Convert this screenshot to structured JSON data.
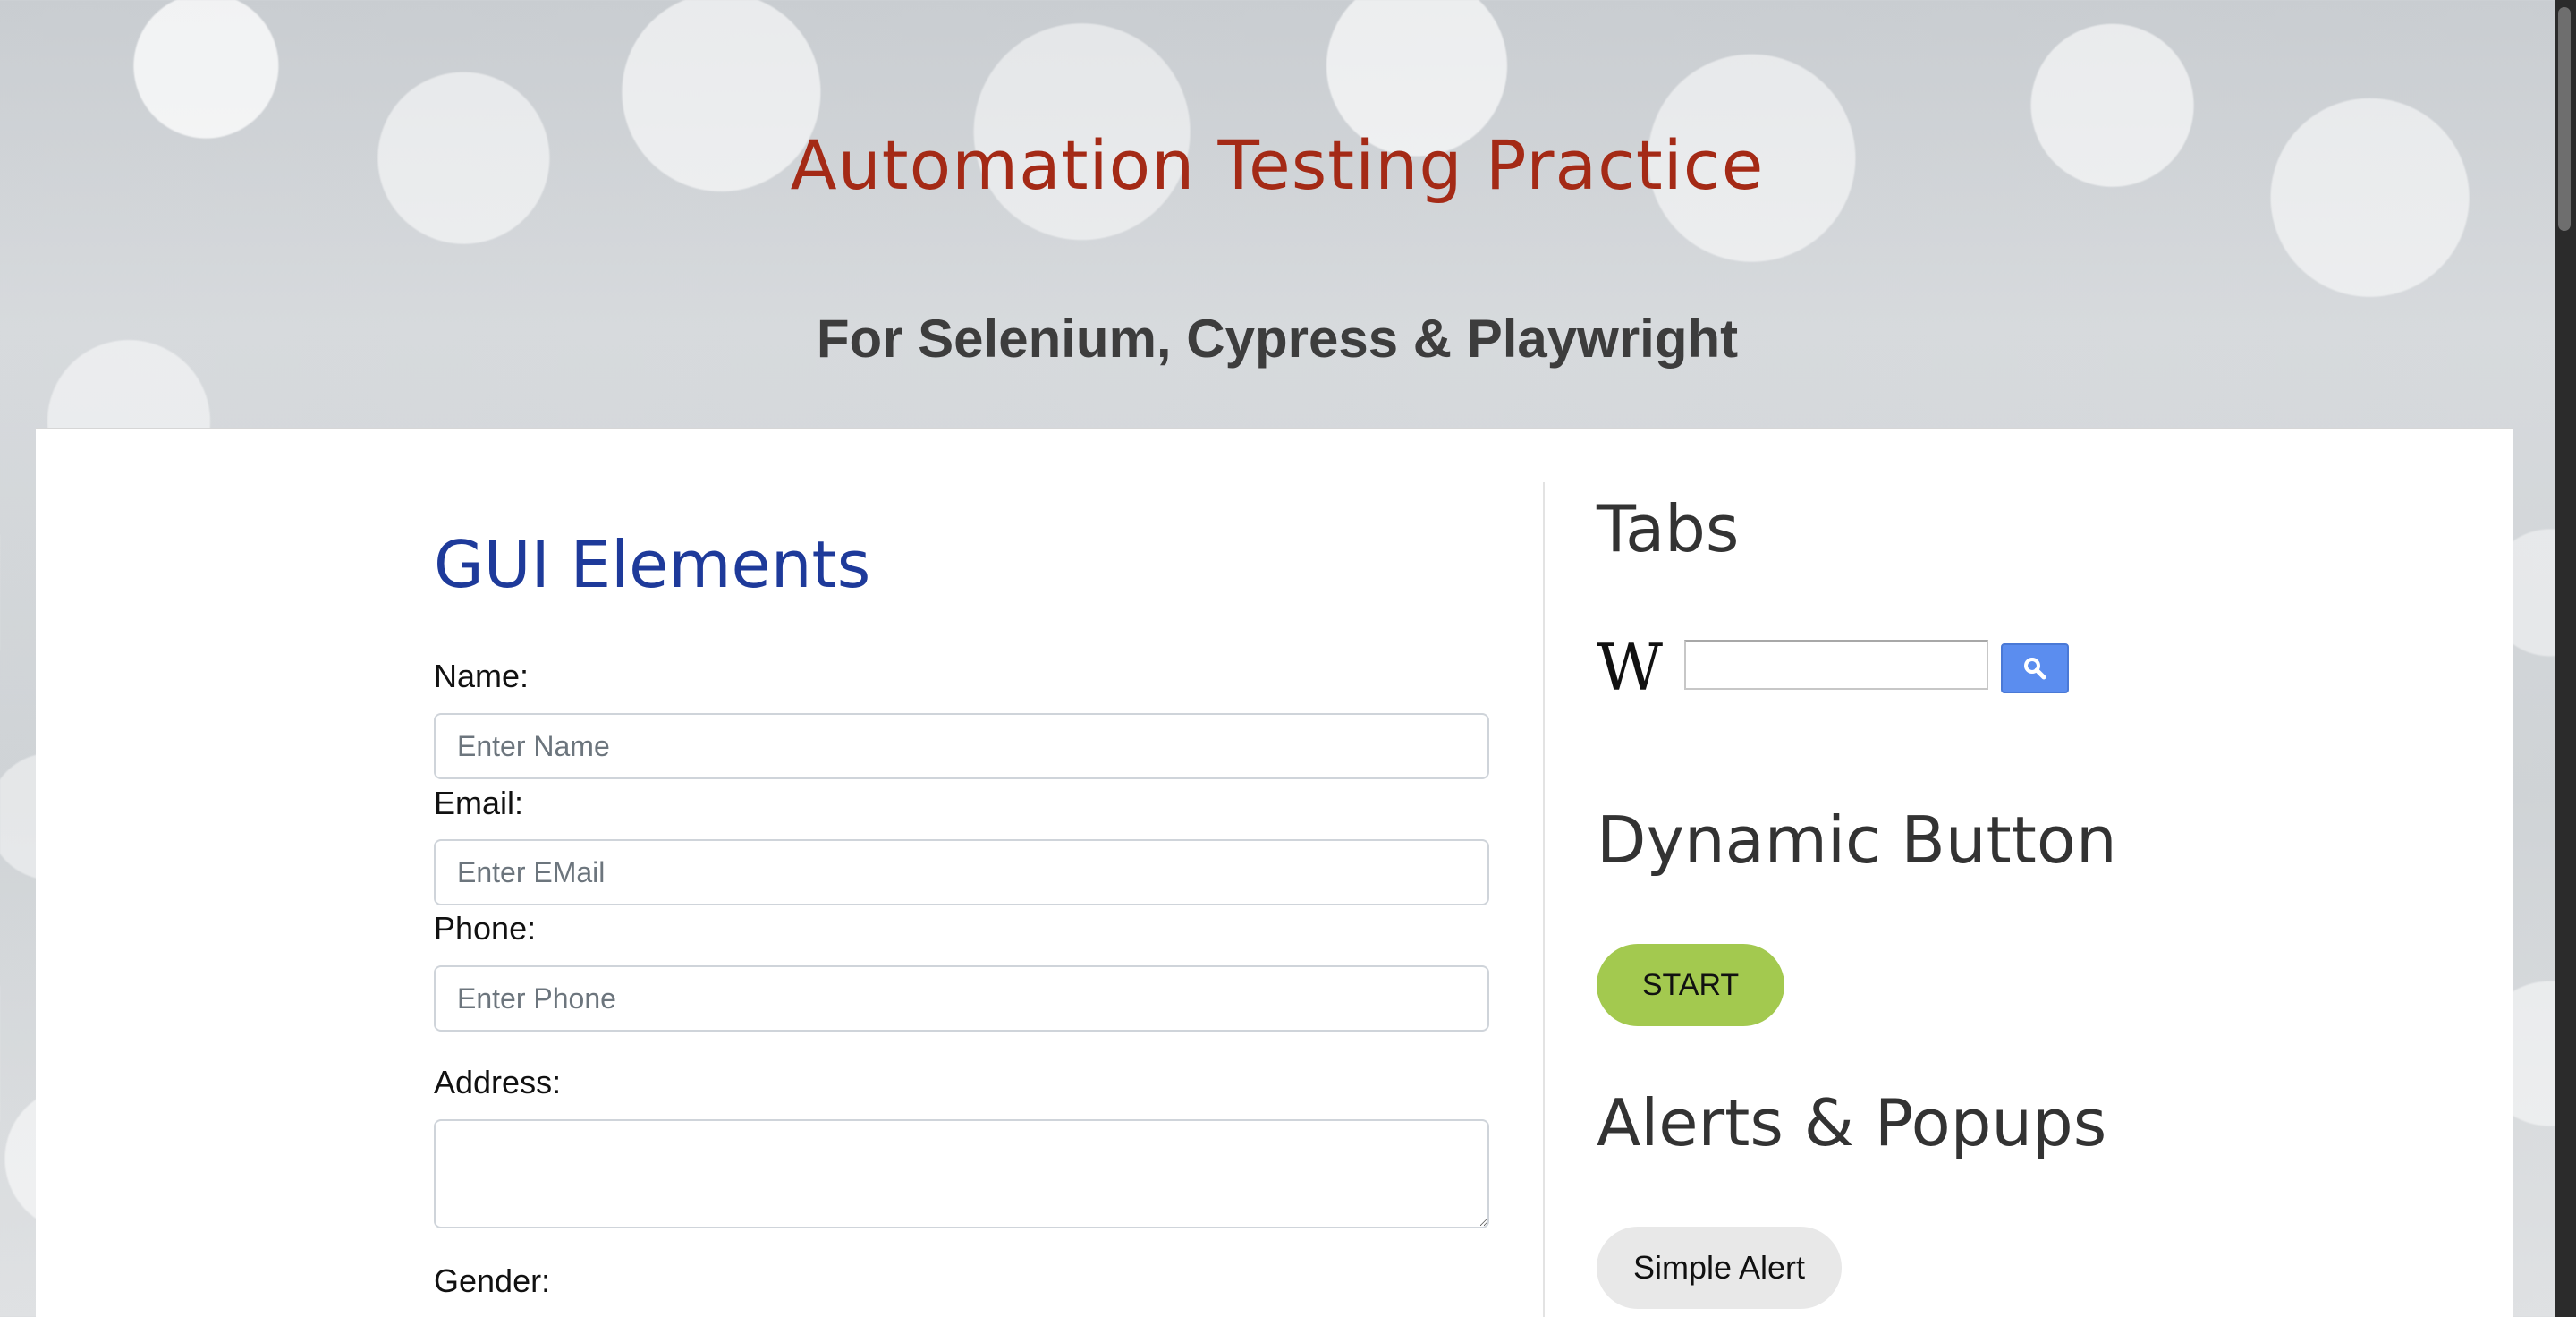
{
  "header": {
    "title": "Automation Testing Practice",
    "tagline": "For Selenium, Cypress & Playwright"
  },
  "gui_elements": {
    "title": "GUI Elements",
    "name": {
      "label": "Name:",
      "placeholder": "Enter Name",
      "value": ""
    },
    "email": {
      "label": "Email:",
      "placeholder": "Enter EMail",
      "value": ""
    },
    "phone": {
      "label": "Phone:",
      "placeholder": "Enter Phone",
      "value": ""
    },
    "address": {
      "label": "Address:",
      "value": ""
    },
    "gender": {
      "label": "Gender:"
    }
  },
  "tabs": {
    "title": "Tabs",
    "wiki_logo": "W",
    "search_value": "",
    "search_icon": "magnifier-icon"
  },
  "dynamic_button": {
    "title": "Dynamic Button",
    "start_label": "START",
    "start_color": "#a3c94f"
  },
  "alerts": {
    "title": "Alerts & Popups",
    "simple_alert_label": "Simple Alert"
  },
  "colors": {
    "title_red": "#a42a16",
    "heading_blue": "#1e3a9a",
    "search_button_blue": "#5b8def"
  }
}
